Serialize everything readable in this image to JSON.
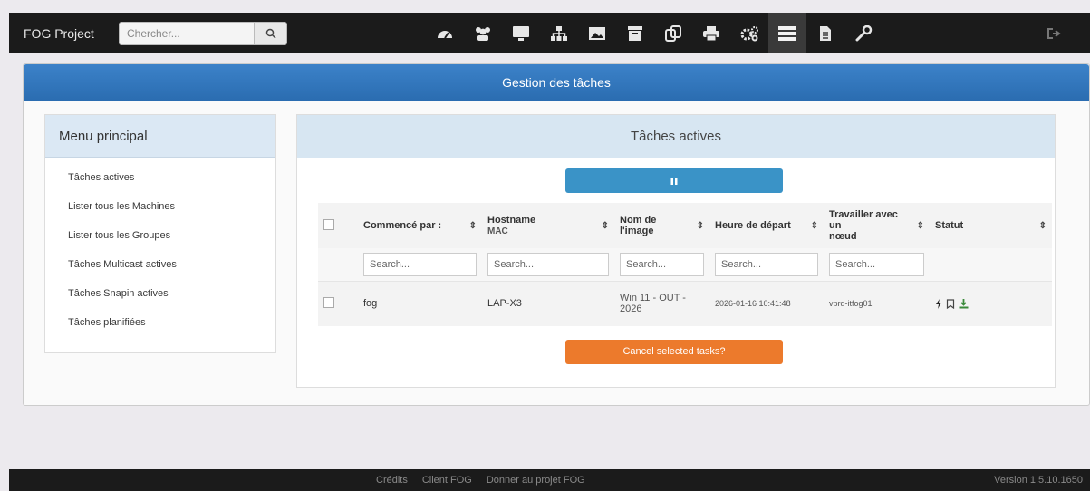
{
  "app": {
    "brand": "FOG Project"
  },
  "search": {
    "placeholder": "Chercher...",
    "icon": "search-icon"
  },
  "nav": {
    "icons": [
      "dashboard-icon",
      "users-icon",
      "monitor-icon",
      "sitemap-icon",
      "image-icon",
      "archive-icon",
      "copy-icon",
      "printer-icon",
      "cogs-icon",
      "server-icon",
      "report-icon",
      "wrench-icon"
    ],
    "active_index": 9,
    "logout_icon": "logout-icon"
  },
  "page": {
    "title": "Gestion des tâches"
  },
  "menu": {
    "title": "Menu principal",
    "items": [
      "Tâches actives",
      "Lister tous les Machines",
      "Lister tous les Groupes",
      "Tâches Multicast actives",
      "Tâches Snapin actives",
      "Tâches planifiées"
    ]
  },
  "panel": {
    "title": "Tâches actives"
  },
  "table": {
    "headers": {
      "started_by": "Commencé par :",
      "hostname": "Hostname",
      "mac": "MAC",
      "image_name_1": "Nom de",
      "image_name_2": "l'image",
      "start_time": "Heure de départ",
      "node_1": "Travailler avec un",
      "node_2": "nœud",
      "status": "Statut"
    },
    "filter_placeholder": "Search...",
    "rows": [
      {
        "started_by": "fog",
        "hostname": "LAP-X3",
        "image_1": "Win 11 - OUT -",
        "image_2": "2026",
        "start_time": "2026-01-16 10:41:48",
        "node": "vprd-itfog01"
      }
    ]
  },
  "buttons": {
    "cancel": "Cancel selected tasks?",
    "pause_icon": "pause-icon"
  },
  "footer": {
    "credits": "Crédits",
    "client": "Client FOG",
    "donate": "Donner au projet FOG",
    "version": "Version 1.5.10.1650"
  },
  "colors": {
    "navbar": "#1b1b1b",
    "banner": "#2f74bb",
    "pause": "#3a93c7",
    "cancel": "#ec7a2c",
    "panel_head": "#d7e6f2"
  }
}
